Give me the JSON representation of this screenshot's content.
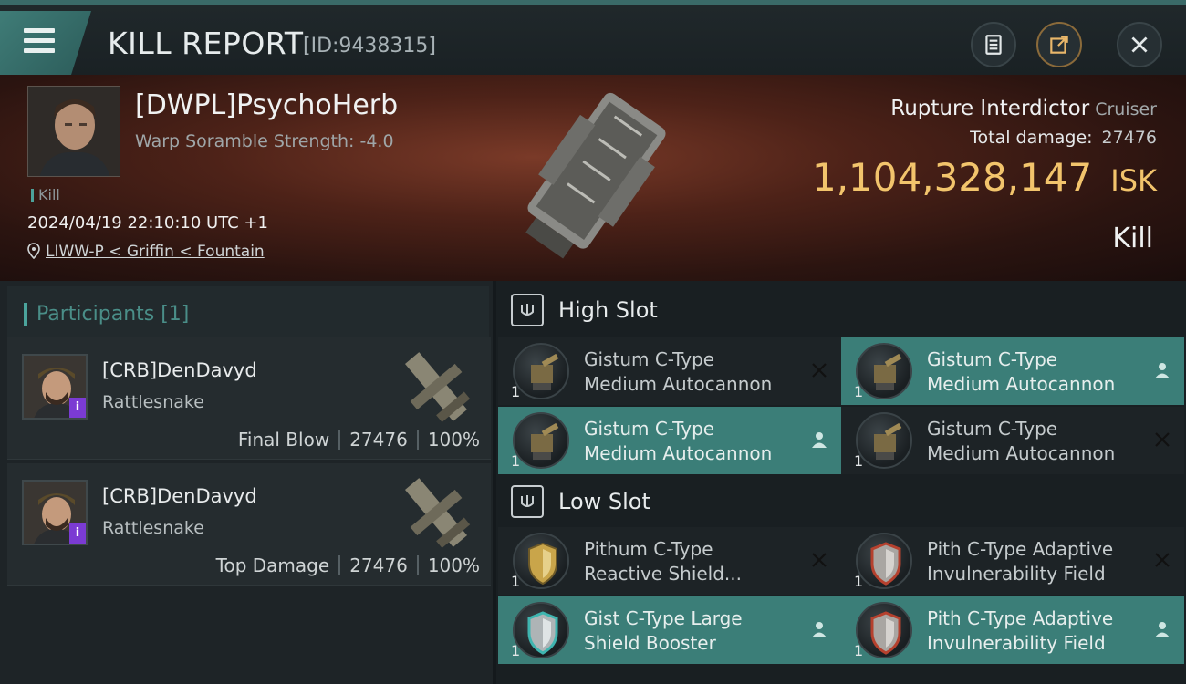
{
  "header": {
    "title": "KILL REPORT",
    "id_label": "[ID:9438315]",
    "buttons": [
      "clipboard-icon",
      "share-icon",
      "close-icon"
    ]
  },
  "victim": {
    "name": "[DWPL]PsychoHerb",
    "scramble": "Warp Soramble Strength: -4.0",
    "tag": "Kill",
    "datetime": "2024/04/19 22:10:10 UTC +1",
    "location": "LIWW-P < Griffin < Fountain",
    "ship_name": "Rupture Interdictor",
    "ship_class": "Cruiser",
    "total_damage_label": "Total damage:",
    "total_damage": "27476",
    "isk_value": "1,104,328,147",
    "isk_unit": "ISK",
    "result": "Kill"
  },
  "participants": {
    "header": "Participants [1]",
    "rows": [
      {
        "name": "[CRB]DenDavyd",
        "ship": "Rattlesnake",
        "role": "Final Blow",
        "damage": "27476",
        "percent": "100%"
      },
      {
        "name": "[CRB]DenDavyd",
        "ship": "Rattlesnake",
        "role": "Top Damage",
        "damage": "27476",
        "percent": "100%"
      }
    ]
  },
  "slots": {
    "high": {
      "label": "High Slot",
      "modules": [
        {
          "line1": "Gistum C-Type",
          "line2": "Medium Autocannon",
          "qty": "1",
          "action": "close-icon"
        },
        {
          "line1": "Gistum C-Type",
          "line2": "Medium Autocannon",
          "qty": "1",
          "action": "person-icon"
        },
        {
          "line1": "Gistum C-Type",
          "line2": "Medium Autocannon",
          "qty": "1",
          "action": "person-icon"
        },
        {
          "line1": "Gistum C-Type",
          "line2": "Medium Autocannon",
          "qty": "1",
          "action": "close-icon"
        }
      ]
    },
    "low": {
      "label": "Low Slot",
      "modules": [
        {
          "line1": "Pithum C-Type",
          "line2": "Reactive Shield...",
          "qty": "1",
          "action": "close-icon"
        },
        {
          "line1": "Pith C-Type Adaptive",
          "line2": "Invulnerability Field",
          "qty": "1",
          "action": "close-icon"
        },
        {
          "line1": "Gist C-Type Large",
          "line2": "Shield Booster",
          "qty": "1",
          "action": "person-icon"
        },
        {
          "line1": "Pith C-Type Adaptive",
          "line2": "Invulnerability Field",
          "qty": "1",
          "action": "person-icon"
        }
      ]
    }
  },
  "colors": {
    "accent": "#3b7e78",
    "isk": "#f2c46c",
    "badge": "#7b3bd3"
  }
}
